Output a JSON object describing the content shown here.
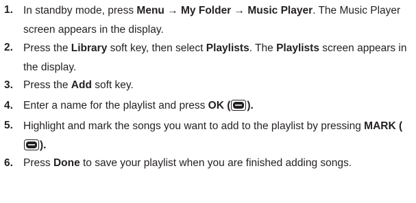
{
  "steps": [
    {
      "num": "1.",
      "a": "In standby mode, press ",
      "b1": "Menu",
      "arrow1": " → ",
      "b2": "My Folder",
      "arrow2": " → ",
      "b3": "Music Player",
      "c": ". The Music Player screen appears in the display."
    },
    {
      "num": "2.",
      "a": "Press the ",
      "b1": "Library",
      "c": " soft key, then select ",
      "b2": "Playlists",
      "d": ". The ",
      "b3": "Playlists",
      "e": " screen appears in the display."
    },
    {
      "num": "3.",
      "a": "Press the ",
      "b1": "Add",
      "c": " soft key."
    },
    {
      "num": "4.",
      "a": "Enter a name for the playlist and press ",
      "b1": "OK",
      "c": " (",
      "icon": "ok-key-icon",
      "d": ")."
    },
    {
      "num": "5.",
      "a": "Highlight and mark the songs you want to add to the playlist by pressing ",
      "b1": "MARK",
      "c": " (",
      "icon": "ok-key-icon",
      "d": ")."
    },
    {
      "num": "6.",
      "a": "Press ",
      "b1": "Done",
      "c": " to save your playlist when you are finished adding songs."
    }
  ],
  "colors": {
    "text": "#231f20",
    "key_fill": "#231f20"
  }
}
